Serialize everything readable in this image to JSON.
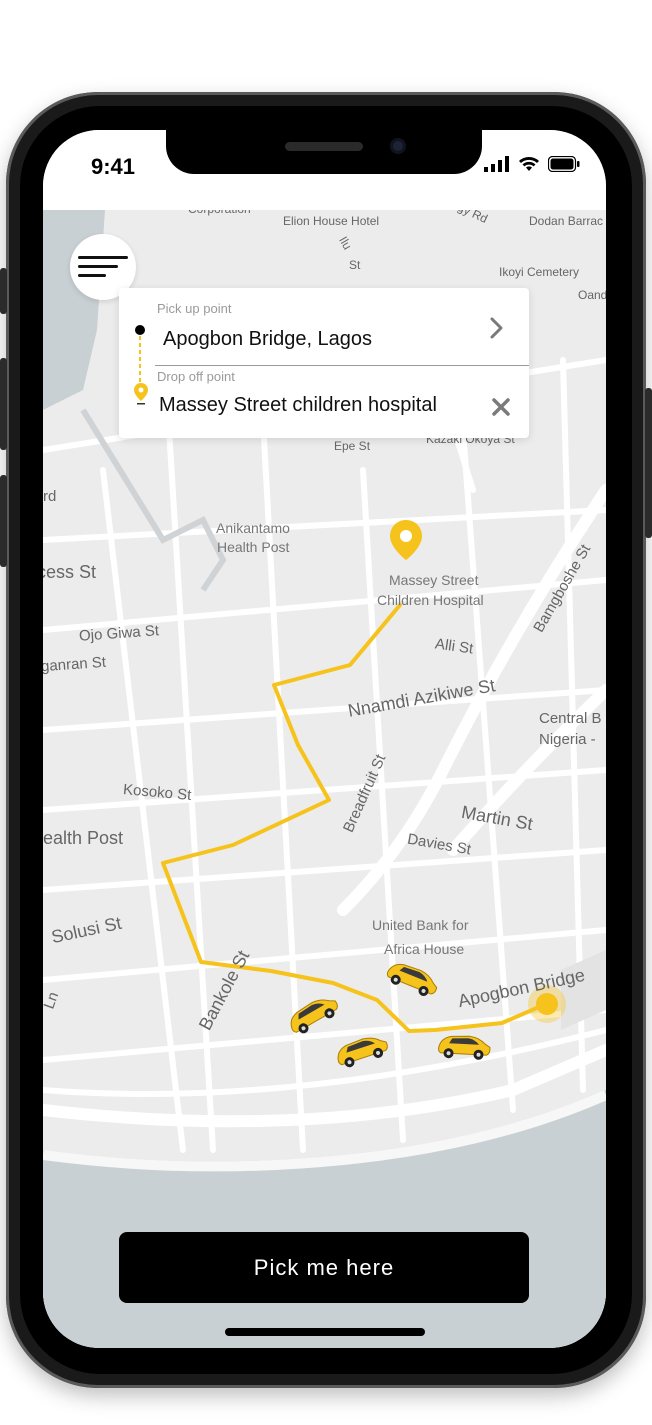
{
  "status_bar": {
    "time": "9:41"
  },
  "route_card": {
    "pickup_label": "Pick up point",
    "pickup_value": "Apogbon Bridge, Lagos",
    "dropoff_label": "Drop off point",
    "dropoff_value": "Massey Street children hospital"
  },
  "map": {
    "labels": {
      "corporation": "Corporation",
      "elion": "Elion House Hotel",
      "ilu": "Ilu",
      "st1": "St",
      "igy_rd": "gy Rd",
      "dodan": "Dodan Barrac",
      "ikoyi": "Ikoyi Cemetery",
      "oand": "Oand",
      "epe": "Epe St",
      "kazaki": "Kazaki Okoya St",
      "rd": "rd",
      "anikantamo": "Anikantamo",
      "health_post_a": "Health Post",
      "massey_l1": "Massey Street",
      "massey_l2": "Children Hospital",
      "bamgboshe": "Bamgboshe St",
      "ess": "cess St",
      "ojo_giwa": "Ojo Giwa St",
      "ganran": "ganran St",
      "alli": "Alli St",
      "nnamdi": "Nnamdi Azikiwe St",
      "central_1": "Central B",
      "central_2": "Nigeria -",
      "kosoko": "Kosoko St",
      "breadfruit": "Breadfruit St",
      "martin": "Martin St",
      "health_post_b": "ealth Post",
      "davies": "Davies St",
      "solusi": "Solusi St",
      "uba_1": "United Bank for",
      "uba_2": "Africa House",
      "ln": "Ln",
      "bankole": "Bankole St",
      "apogbon": "Apogbon Bridge"
    }
  },
  "cta": {
    "label": "Pick me here"
  },
  "colors": {
    "accent": "#F6C21C",
    "button_bg": "#000000",
    "map_bg": "#ECECEC",
    "water": "#C9D0D4"
  }
}
